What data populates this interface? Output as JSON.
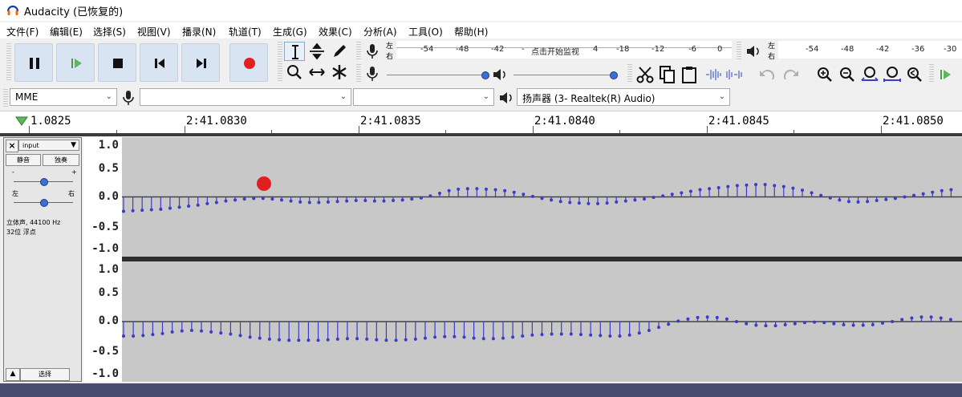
{
  "app": {
    "title": "Audacity (已恢复的)"
  },
  "menu": [
    "文件(F)",
    "编辑(E)",
    "选择(S)",
    "视图(V)",
    "播录(N)",
    "轨道(T)",
    "生成(G)",
    "效果(C)",
    "分析(A)",
    "工具(O)",
    "帮助(H)"
  ],
  "colors": {
    "accent": "#3c3cc8",
    "record": "#e02020",
    "play": "#5cb85c",
    "waveform_bg": "#c8c8c8",
    "transport_bg": "#d8e4f2"
  },
  "transport": {
    "icons": [
      "pause-icon",
      "play-icon",
      "stop-icon",
      "skip-start-icon",
      "skip-end-icon",
      "record-icon"
    ]
  },
  "meters": {
    "record_lr_top": "左",
    "record_lr_bottom": "右",
    "record_scale": [
      "-54",
      "-48",
      "-42",
      "-",
      "4",
      "-18",
      "-12",
      "-6",
      "0"
    ],
    "record_hint": "点击开始监视",
    "play_lr_top": "左",
    "play_lr_bottom": "右",
    "play_scale": [
      "-54",
      "-48",
      "-42",
      "-36",
      "-30"
    ]
  },
  "device": {
    "host": "MME",
    "record_device": "",
    "channels": "",
    "playback_device": "扬声器 (3- Realtek(R) Audio)"
  },
  "ruler": {
    "labels": [
      "1.0825",
      "2:41.0830",
      "2:41.0835",
      "2:41.0840",
      "2:41.0845",
      "2:41.0850"
    ]
  },
  "track": {
    "name": "input",
    "mute_label": "静音",
    "solo_label": "独奏",
    "gain_minus": "-",
    "gain_plus": "+",
    "pan_left": "左",
    "pan_right": "右",
    "info_line1": "立体声, 44100 Hz",
    "info_line2": "32位 浮点",
    "select_label": "选择",
    "axis_labels": [
      "1.0",
      "0.5",
      "0.0",
      "-0.5",
      "-1.0"
    ]
  },
  "waveform": {
    "left_samples": [
      -0.28,
      -0.27,
      -0.26,
      -0.25,
      -0.24,
      -0.22,
      -0.2,
      -0.18,
      -0.16,
      -0.13,
      -0.11,
      -0.08,
      -0.06,
      -0.04,
      -0.03,
      -0.03,
      -0.04,
      -0.06,
      -0.08,
      -0.1,
      -0.11,
      -0.11,
      -0.1,
      -0.09,
      -0.08,
      -0.07,
      -0.07,
      -0.08,
      -0.08,
      -0.07,
      -0.06,
      -0.04,
      -0.02,
      0.02,
      0.07,
      0.12,
      0.15,
      0.16,
      0.16,
      0.15,
      0.14,
      0.12,
      0.09,
      0.05,
      0.01,
      -0.03,
      -0.06,
      -0.09,
      -0.11,
      -0.12,
      -0.13,
      -0.13,
      -0.12,
      -0.1,
      -0.08,
      -0.06,
      -0.04,
      -0.01,
      0.02,
      0.05,
      0.08,
      0.11,
      0.14,
      0.16,
      0.18,
      0.2,
      0.22,
      0.23,
      0.24,
      0.24,
      0.22,
      0.2,
      0.17,
      0.13,
      0.08,
      0.03,
      -0.02,
      -0.06,
      -0.09,
      -0.1,
      -0.09,
      -0.07,
      -0.05,
      -0.03,
      0.0,
      0.03,
      0.06,
      0.09,
      0.12,
      0.14
    ],
    "right_samples": [
      -0.28,
      -0.28,
      -0.27,
      -0.25,
      -0.23,
      -0.2,
      -0.18,
      -0.17,
      -0.18,
      -0.2,
      -0.22,
      -0.24,
      -0.27,
      -0.3,
      -0.32,
      -0.34,
      -0.35,
      -0.36,
      -0.36,
      -0.36,
      -0.36,
      -0.35,
      -0.34,
      -0.33,
      -0.33,
      -0.34,
      -0.35,
      -0.36,
      -0.36,
      -0.35,
      -0.34,
      -0.32,
      -0.3,
      -0.29,
      -0.29,
      -0.3,
      -0.32,
      -0.33,
      -0.33,
      -0.32,
      -0.3,
      -0.28,
      -0.26,
      -0.25,
      -0.24,
      -0.24,
      -0.24,
      -0.25,
      -0.26,
      -0.27,
      -0.28,
      -0.28,
      -0.26,
      -0.22,
      -0.17,
      -0.11,
      -0.05,
      0.01,
      0.05,
      0.08,
      0.09,
      0.08,
      0.05,
      0.0,
      -0.04,
      -0.07,
      -0.08,
      -0.08,
      -0.06,
      -0.04,
      -0.02,
      -0.01,
      -0.02,
      -0.04,
      -0.06,
      -0.07,
      -0.07,
      -0.06,
      -0.03,
      0.0,
      0.04,
      0.07,
      0.09,
      0.09,
      0.07,
      0.04
    ]
  }
}
